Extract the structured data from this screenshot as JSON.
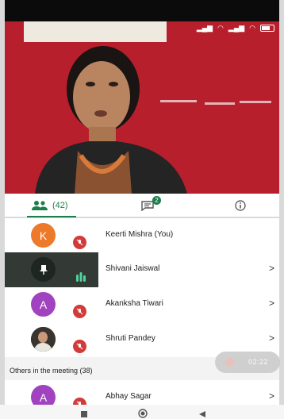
{
  "status_bar": {
    "icons": [
      "signal-icon",
      "wifi-icon",
      "signal-icon",
      "wifi-icon",
      "battery-icon"
    ]
  },
  "tabs": {
    "people": {
      "icon": "people-icon",
      "count": "(42)"
    },
    "chat": {
      "icon": "chat-icon",
      "badge": "2"
    },
    "info": {
      "icon": "info-icon"
    }
  },
  "participants": [
    {
      "name": "Keerti Mishra (You)",
      "initial": "K",
      "avatar_color": "#ec7a2a",
      "mic": "muted"
    },
    {
      "name": "Shivani Jaiswal",
      "icon": "pin-icon",
      "speaking": true
    },
    {
      "name": "Akanksha Tiwari",
      "initial": "A",
      "avatar_color": "#a142c0",
      "mic": "muted"
    },
    {
      "name": "Shruti Pandey",
      "avatar": "photo",
      "mic": "muted"
    }
  ],
  "others_section": {
    "label": "Others in the meeting (38)"
  },
  "others": [
    {
      "name": "Abhay Sagar",
      "initial": "A",
      "avatar_color": "#a142c0",
      "mic": "muted"
    }
  ],
  "recording": {
    "time": "02:22"
  },
  "nav": {
    "buttons": [
      "recent-apps-icon",
      "home-icon",
      "back-icon"
    ]
  },
  "colors": {
    "accent": "#1b7f4a",
    "muted_red": "#d33b3b",
    "wall_red": "#b81f2c"
  }
}
